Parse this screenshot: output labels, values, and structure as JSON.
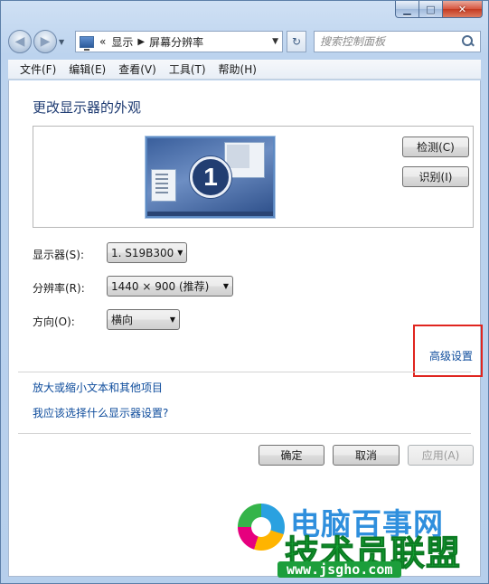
{
  "window": {
    "caption_buttons": [
      "minimize",
      "maximize",
      "close"
    ]
  },
  "nav": {
    "back_icon": "back-arrow-icon",
    "forward_icon": "forward-arrow-icon",
    "address": {
      "prefix": "«",
      "crumb1": "显示",
      "crumb2": "屏幕分辨率"
    },
    "search_placeholder": "搜索控制面板"
  },
  "menubar": {
    "items": [
      "文件(F)",
      "编辑(E)",
      "查看(V)",
      "工具(T)",
      "帮助(H)"
    ]
  },
  "main": {
    "title": "更改显示器的外观",
    "monitor_number": "1",
    "detect_label": "检测(C)",
    "identify_label": "识别(I)",
    "display_label": "显示器(S):",
    "display_value": "1. S19B300",
    "resolution_label": "分辨率(R):",
    "resolution_value": "1440 × 900 (推荐)",
    "orientation_label": "方向(O):",
    "orientation_value": "横向",
    "advanced_link": "高级设置",
    "link_text_size": "放大或缩小文本和其他项目",
    "link_which_settings": "我应该选择什么显示器设置?",
    "ok_label": "确定",
    "cancel_label": "取消",
    "apply_label": "应用(A)"
  },
  "watermark": {
    "line1": "电脑百事网",
    "line2": "技术员联盟",
    "url": "www.jsgho.com"
  },
  "colors": {
    "link": "#0e4c9c",
    "title": "#1e3b72",
    "highlight": "#e0251f"
  }
}
